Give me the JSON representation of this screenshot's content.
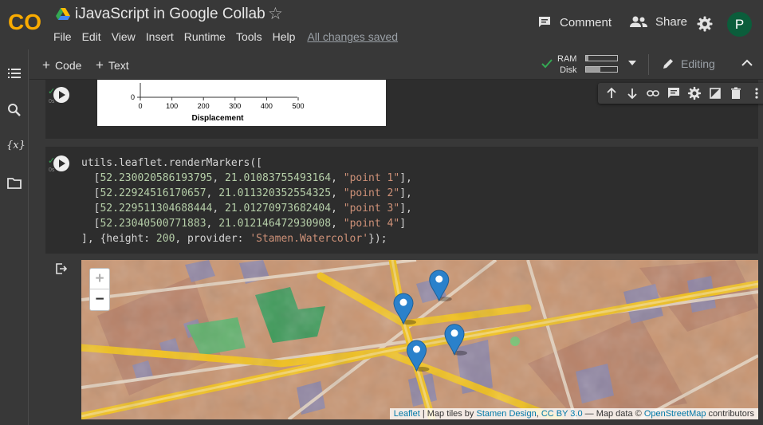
{
  "app": {
    "logo_text": "CO",
    "document_title": "iJavaScript in Google Collab",
    "menu": [
      "File",
      "Edit",
      "View",
      "Insert",
      "Runtime",
      "Tools",
      "Help"
    ],
    "save_status": "All changes saved",
    "comment_label": "Comment",
    "share_label": "Share",
    "avatar_initial": "P"
  },
  "toolbar": {
    "add_code_label": "Code",
    "add_text_label": "Text",
    "ram_label": "RAM",
    "disk_label": "Disk",
    "ram_usage": 0.08,
    "disk_usage": 0.45,
    "mode_label": "Editing"
  },
  "sidebar": {
    "items": [
      {
        "icon": "table-of-contents-icon"
      },
      {
        "icon": "search-icon"
      },
      {
        "icon": "variables-icon",
        "glyph": "{x}"
      },
      {
        "icon": "folder-icon"
      }
    ]
  },
  "cells": [
    {
      "exec_time": "0s",
      "output_chart": {
        "x_ticks": [
          "0",
          "100",
          "200",
          "300",
          "400",
          "500"
        ],
        "y_ticks": [
          "0"
        ],
        "xlabel": "Displacement"
      }
    },
    {
      "exec_time": "0s",
      "code": {
        "line1": "utils.leaflet.renderMarkers([",
        "points": [
          {
            "lat": "52.230020586193795",
            "lng": "21.01083755493164",
            "label": "\"point 1\""
          },
          {
            "lat": "52.22924516170657",
            "lng": "21.011320352554325",
            "label": "\"point 2\""
          },
          {
            "lat": "52.229511304688444",
            "lng": "21.01270973682404",
            "label": "\"point 3\""
          },
          {
            "lat": "52.23040500771883",
            "lng": "21.012146472930908",
            "label": "\"point 4\""
          }
        ],
        "opts_pre": "], {height: ",
        "height": "200",
        "opts_mid": ", provider: ",
        "provider": "'Stamen.Watercolor'",
        "opts_post": "});"
      },
      "map": {
        "zoom_in": "+",
        "zoom_out": "−",
        "attribution": {
          "leaflet": "Leaflet",
          "sep1": " | Map tiles by ",
          "stamen": "Stamen Design",
          "sep2": ", ",
          "license": "CC BY 3.0",
          "sep3": " — Map data © ",
          "osm": "OpenStreetMap",
          "sep4": " contributors"
        }
      }
    }
  ],
  "colors": {
    "background": "#383838",
    "cell_background": "#2d2d2d",
    "accent_orange": "#f9ab00",
    "marker_blue": "#2a81cb",
    "success_green": "#34a853"
  }
}
